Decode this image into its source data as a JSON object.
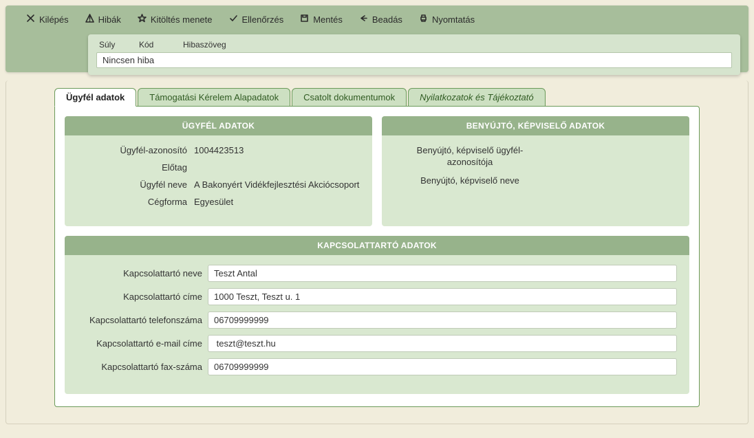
{
  "toolbar": {
    "items": [
      {
        "id": "exit",
        "label": "Kilépés",
        "icon": "close"
      },
      {
        "id": "errors",
        "label": "Hibák",
        "icon": "warn"
      },
      {
        "id": "steps",
        "label": "Kitöltés menete",
        "icon": "star"
      },
      {
        "id": "check",
        "label": "Ellenőrzés",
        "icon": "check"
      },
      {
        "id": "save",
        "label": "Mentés",
        "icon": "save"
      },
      {
        "id": "submit",
        "label": "Beadás",
        "icon": "reply"
      },
      {
        "id": "print",
        "label": "Nyomtatás",
        "icon": "print"
      }
    ]
  },
  "error_panel": {
    "columns": {
      "weight": "Súly",
      "code": "Kód",
      "msg": "Hibaszöveg"
    },
    "row_text": "Nincsen hiba"
  },
  "tabs": [
    {
      "label": "Ügyfél adatok",
      "active": true
    },
    {
      "label": "Támogatási Kérelem Alapadatok",
      "active": false
    },
    {
      "label": "Csatolt dokumentumok",
      "active": false
    },
    {
      "label": "Nyilatkozatok és Tájékoztató",
      "active": false,
      "italic": true
    }
  ],
  "client_card": {
    "title": "ÜGYFÉL ADATOK",
    "rows": {
      "id_label": "Ügyfél-azonosító",
      "id_value": "1004423513",
      "prefix_label": "Előtag",
      "prefix_value": "",
      "name_label": "Ügyfél neve",
      "name_value": "A Bakonyért Vidékfejlesztési Akciócsoport",
      "form_label": "Cégforma",
      "form_value": "Egyesület"
    }
  },
  "submitter_card": {
    "title": "BENYÚJTÓ, KÉPVISELŐ ADATOK",
    "rows": {
      "id_label": "Benyújtó, képviselő ügyfél-azonosítója",
      "name_label": "Benyújtó, képviselő neve"
    }
  },
  "contact_card": {
    "title": "KAPCSOLATTARTÓ ADATOK",
    "fields": {
      "name": {
        "label": "Kapcsolattartó neve",
        "value": "Teszt Antal"
      },
      "addr": {
        "label": "Kapcsolattartó címe",
        "value": "1000 Teszt, Teszt u. 1"
      },
      "phone": {
        "label": "Kapcsolattartó telefonszáma",
        "value": "06709999999"
      },
      "email": {
        "label": "Kapcsolattartó e-mail címe",
        "value": " teszt@teszt.hu"
      },
      "fax": {
        "label": "Kapcsolattartó fax-száma",
        "value": "06709999999"
      }
    }
  }
}
